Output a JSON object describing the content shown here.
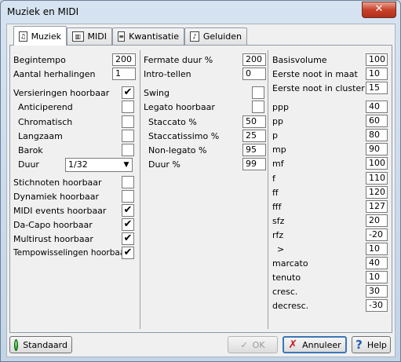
{
  "window": {
    "title": "Muziek en MIDI",
    "close_label": "✕"
  },
  "tabs": [
    {
      "label": "Muziek",
      "icon": "music-icon"
    },
    {
      "label": "MIDI",
      "icon": "midi-icon"
    },
    {
      "label": "Kwantisatie",
      "icon": "quantize-icon"
    },
    {
      "label": "Geluiden",
      "icon": "sounds-icon"
    }
  ],
  "col1": {
    "begintempo": {
      "label": "Begintempo",
      "value": "200"
    },
    "herhalingen": {
      "label": "Aantal herhalingen",
      "value": "1"
    },
    "versieringen": {
      "label": "Versieringen hoorbaar",
      "checked": "✔"
    },
    "anticiperend": {
      "label": "Anticiperend",
      "checked": ""
    },
    "chromatisch": {
      "label": "Chromatisch",
      "checked": ""
    },
    "langzaam": {
      "label": "Langzaam",
      "checked": ""
    },
    "barok": {
      "label": "Barok",
      "checked": ""
    },
    "duur": {
      "label": "Duur",
      "value": "1/32"
    },
    "stichnoten": {
      "label": "Stichnoten hoorbaar",
      "checked": ""
    },
    "dynamiek": {
      "label": "Dynamiek hoorbaar",
      "checked": ""
    },
    "midi_events": {
      "label": "MIDI events hoorbaar",
      "checked": "✔"
    },
    "dacapo": {
      "label": "Da-Capo hoorbaar",
      "checked": "✔"
    },
    "multirust": {
      "label": "Multirust hoorbaar",
      "checked": "✔"
    },
    "tempowisselingen": {
      "label": "Tempowisselingen hoorbaar",
      "checked": "✔"
    }
  },
  "col2": {
    "fermate": {
      "label": "Fermate duur %",
      "value": "200"
    },
    "intro": {
      "label": "Intro-tellen",
      "value": "0"
    },
    "swing": {
      "label": "Swing",
      "checked": ""
    },
    "legato": {
      "label": "Legato hoorbaar",
      "checked": ""
    },
    "staccato": {
      "label": "Staccato %",
      "value": "50"
    },
    "staccatissimo": {
      "label": "Staccatissimo %",
      "value": "25"
    },
    "nonlegato": {
      "label": "Non-legato %",
      "value": "95"
    },
    "duur": {
      "label": "Duur %",
      "value": "99"
    }
  },
  "col3": {
    "basisvolume": {
      "label": "Basisvolume",
      "value": "100"
    },
    "eerste_maat": {
      "label": "Eerste noot in maat",
      "value": "10"
    },
    "eerste_cluster": {
      "label": "Eerste noot in cluster",
      "value": "15"
    },
    "dyn": [
      {
        "label": "ppp",
        "value": "40"
      },
      {
        "label": "pp",
        "value": "60"
      },
      {
        "label": "p",
        "value": "80"
      },
      {
        "label": "mp",
        "value": "90"
      },
      {
        "label": "mf",
        "value": "100"
      },
      {
        "label": "f",
        "value": "110"
      },
      {
        "label": "ff",
        "value": "120"
      },
      {
        "label": "fff",
        "value": "127"
      },
      {
        "label": "sfz",
        "value": "20"
      },
      {
        "label": "rfz",
        "value": "-20"
      },
      {
        "label": ">",
        "value": "10"
      },
      {
        "label": "marcato",
        "value": "40"
      },
      {
        "label": "tenuto",
        "value": "10"
      },
      {
        "label": "cresc.",
        "value": "30"
      },
      {
        "label": "decresc.",
        "value": "-30"
      }
    ]
  },
  "footer": {
    "standaard": "Standaard",
    "ok": "OK",
    "annuleer": "Annuleer",
    "help": "Help"
  }
}
